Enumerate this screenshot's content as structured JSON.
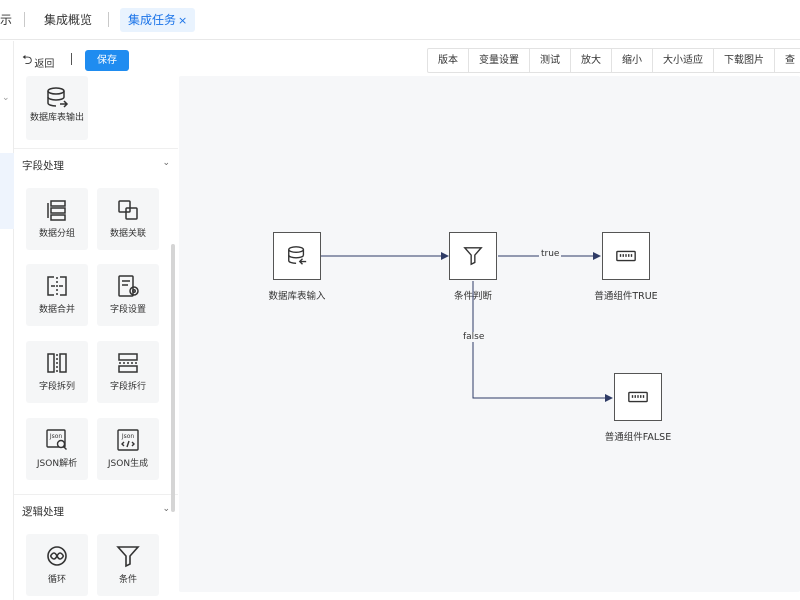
{
  "tabs": {
    "partial": "示",
    "overview": "集成概览",
    "active": "集成任务",
    "close": "×"
  },
  "toolbar": {
    "back": "返回",
    "save": "保存",
    "buttons": [
      "版本",
      "变量设置",
      "测试",
      "放大",
      "缩小",
      "大小适应",
      "下载图片",
      "查"
    ]
  },
  "palette": {
    "top_item": "数据库表输出",
    "sections": [
      {
        "title": "字段处理",
        "items": [
          "数据分组",
          "数据关联",
          "数据合并",
          "字段设置",
          "字段拆列",
          "字段拆行",
          "JSON解析",
          "JSON生成"
        ]
      },
      {
        "title": "逻辑处理",
        "items": [
          "循环",
          "条件"
        ]
      }
    ]
  },
  "flow": {
    "nodes": {
      "input": "数据库表输入",
      "condition": "条件判断",
      "true_node": "普通组件TRUE",
      "false_node": "普通组件FALSE"
    },
    "edges": {
      "true": "true",
      "false": "false"
    }
  },
  "colors": {
    "accent": "#1f8cf0",
    "edge": "#2f3b66",
    "canvas": "#f6f7f9"
  }
}
